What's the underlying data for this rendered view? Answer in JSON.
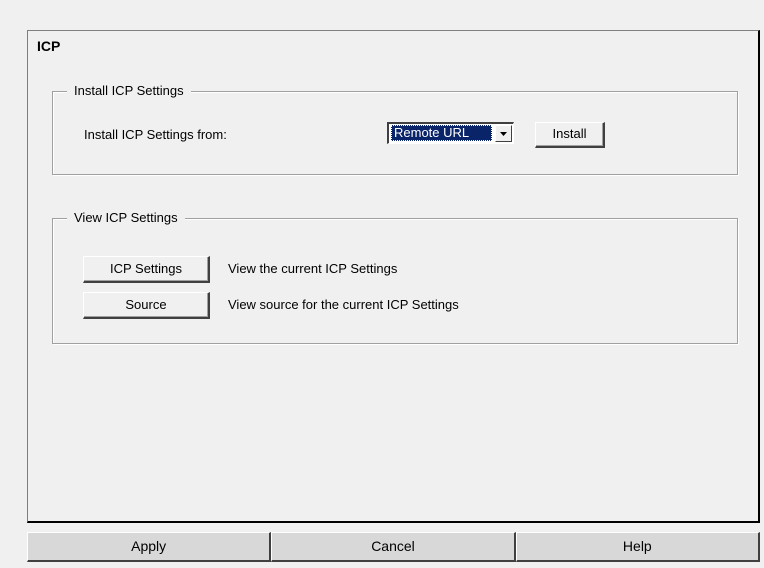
{
  "panel": {
    "title": "ICP"
  },
  "install_group": {
    "legend": "Install ICP Settings",
    "from_label": "Install ICP Settings from:",
    "source_select": {
      "selected": "Remote URL"
    },
    "install_button": "Install"
  },
  "view_group": {
    "legend": "View ICP Settings",
    "rows": [
      {
        "button": "ICP Settings",
        "description": "View the current ICP Settings"
      },
      {
        "button": "Source",
        "description": "View source for the current ICP Settings"
      }
    ]
  },
  "footer": {
    "apply": "Apply",
    "cancel": "Cancel",
    "help": "Help"
  },
  "icons": {
    "dropdown": "chevron-down-icon"
  },
  "colors": {
    "selection_bg": "#0a246a",
    "face": "#f0f0f0"
  }
}
